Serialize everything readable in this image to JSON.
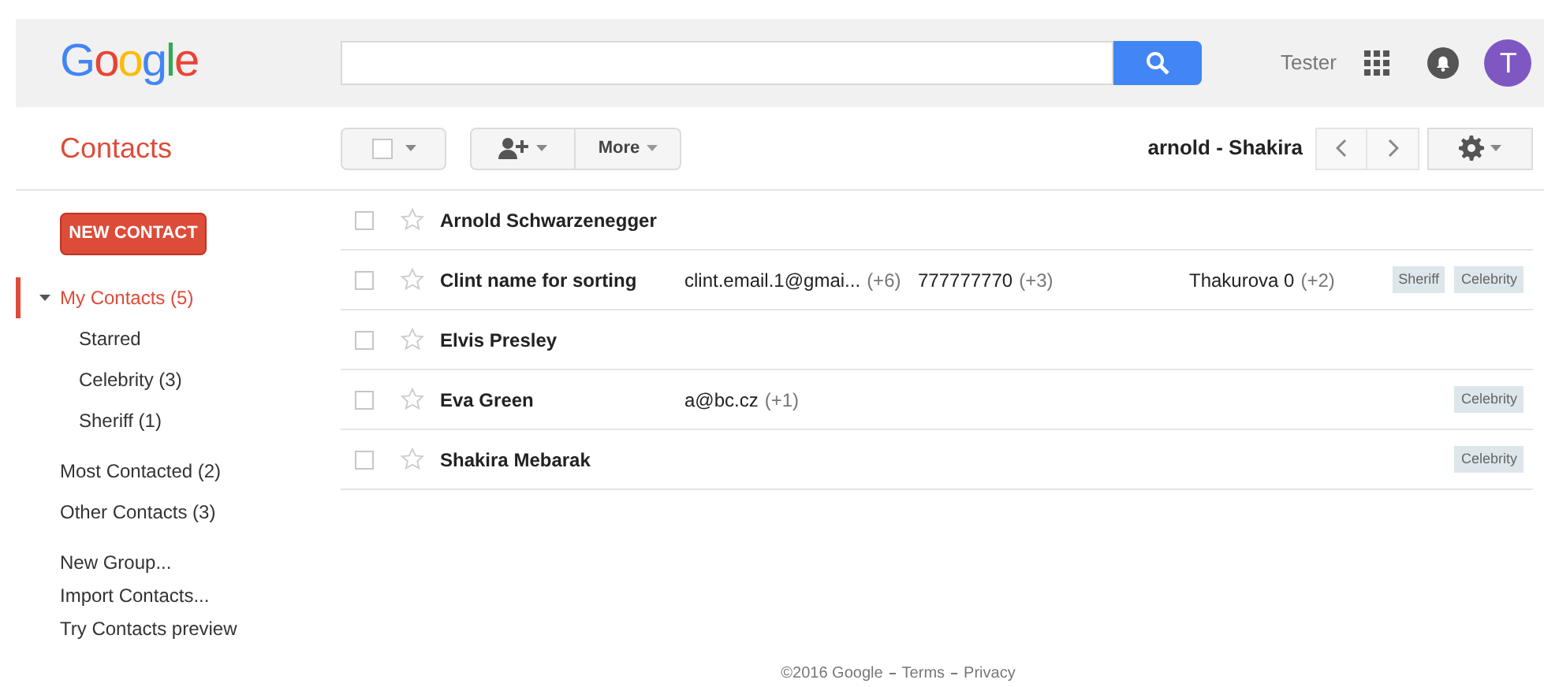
{
  "header": {
    "logo": "Google",
    "user_name": "Tester",
    "avatar_initial": "T"
  },
  "app_title": "Contacts",
  "toolbar": {
    "more_label": "More",
    "range": "arnold - Shakira"
  },
  "sidebar": {
    "new_contact": "NEW CONTACT",
    "items": [
      {
        "label": "My Contacts (5)",
        "selected": true,
        "expanded": true,
        "children": [
          {
            "label": "Starred",
            "selected": false
          },
          {
            "label": "Celebrity (3)",
            "selected": false
          },
          {
            "label": "Sheriff (1)",
            "selected": false
          }
        ]
      },
      {
        "label": "Most Contacted (2)",
        "selected": false
      },
      {
        "label": "Other Contacts (3)",
        "selected": false
      }
    ],
    "links": [
      "New Group...",
      "Import Contacts...",
      "Try Contacts preview"
    ]
  },
  "contacts": [
    {
      "name": "Arnold Schwarzenegger",
      "checked": false,
      "starred": false
    },
    {
      "name": "Clint name for sorting",
      "checked": false,
      "starred": false,
      "email": "clint.email.1@gmai...",
      "email_more": "(+6)",
      "phone": "777777770",
      "phone_more": "(+3)",
      "other": "Thakurova 0",
      "other_more": "(+2)",
      "tags": [
        "Sheriff",
        "Celebrity"
      ]
    },
    {
      "name": "Elvis Presley",
      "checked": false,
      "starred": false
    },
    {
      "name": "Eva Green",
      "checked": false,
      "starred": false,
      "email": "a@bc.cz",
      "email_more": "(+1)",
      "tags": [
        "Celebrity"
      ]
    },
    {
      "name": "Shakira Mebarak",
      "checked": false,
      "starred": false,
      "tags": [
        "Celebrity"
      ]
    }
  ],
  "footer": [
    "©2016 Google",
    "Terms",
    "Privacy"
  ]
}
